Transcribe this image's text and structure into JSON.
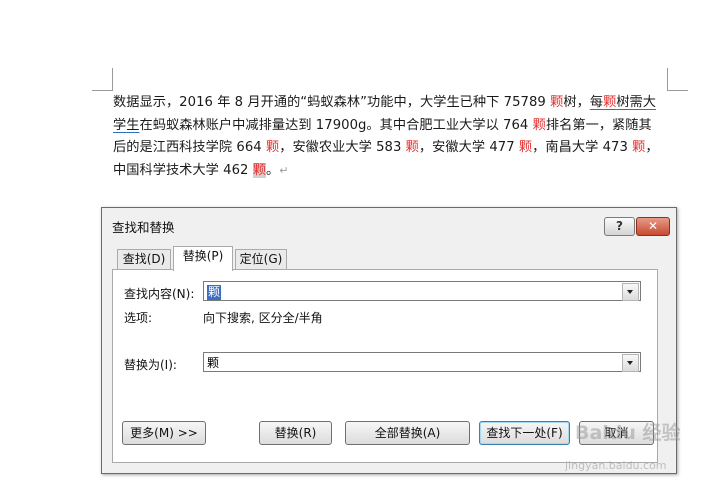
{
  "document": {
    "line1": [
      {
        "t": "数据显示，2016 年 8 月开通的“蚂蚁森林”功能中，大学生已种下 75789 "
      },
      {
        "t": "颗",
        "c": "red"
      },
      {
        "t": "树，"
      },
      {
        "t": "每",
        "c": "ul"
      },
      {
        "t": "颗",
        "c": "red ul"
      },
      {
        "t": "树需大",
        "c": "ul"
      }
    ],
    "line2": [
      {
        "t": "学生",
        "c": "ul"
      },
      {
        "t": "在蚂蚁森林账户中减排量达到 17900g。其中合肥工业大学以 764 "
      },
      {
        "t": "颗",
        "c": "red"
      },
      {
        "t": "排名第一，紧随其"
      }
    ],
    "line3": [
      {
        "t": "后的是江西科技学院 664 "
      },
      {
        "t": "颗",
        "c": "red"
      },
      {
        "t": "，安徽农业大学 583 "
      },
      {
        "t": "颗",
        "c": "red"
      },
      {
        "t": "，安徽大学 477 "
      },
      {
        "t": "颗",
        "c": "red"
      },
      {
        "t": "，南昌大学 473 "
      },
      {
        "t": "颗",
        "c": "red"
      },
      {
        "t": "，"
      }
    ],
    "line4": [
      {
        "t": "中国科学技术大学 462 "
      },
      {
        "t": "颗",
        "c": "red hl"
      },
      {
        "t": "。"
      },
      {
        "t": "↵",
        "c": "pilcrow"
      }
    ]
  },
  "dialog": {
    "title": "查找和替换",
    "help_label": "?",
    "close_label": "✕",
    "tabs": [
      {
        "label": "查找(D)"
      },
      {
        "label": "替换(P)",
        "selected": true
      },
      {
        "label": "定位(G)"
      }
    ],
    "find_label": "查找内容(N):",
    "find_value": "颗",
    "options_label": "选项:",
    "options_value": "向下搜索, 区分全/半角",
    "replace_label": "替换为(I):",
    "replace_value": "颗",
    "buttons": {
      "more": "更多(M) >>",
      "replace": "替换(R)",
      "replace_all": "全部替换(A)",
      "find_next": "查找下一处(F)",
      "cancel": "取消"
    }
  },
  "watermark": {
    "logo": "Baidu 经验",
    "url": "jingyan.baidu.com"
  }
}
